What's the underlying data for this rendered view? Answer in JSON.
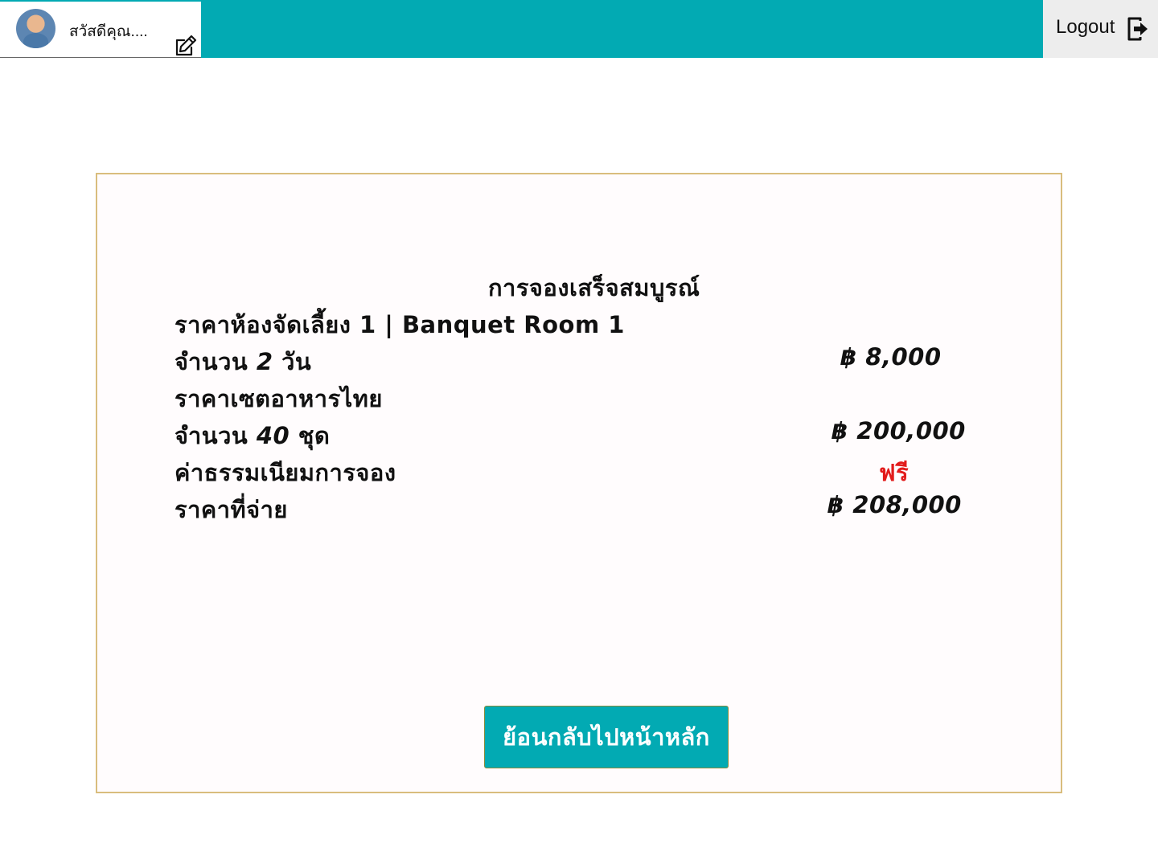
{
  "header": {
    "greeting": "สวัสดีคุณ....",
    "logout_label": "Logout"
  },
  "summary": {
    "title": "การจองเสร็จสมบูรณ์",
    "room_label": "ราคาห้องจัดเลี้ยง 1 | Banquet Room 1",
    "days_prefix": "จำนวน ",
    "days_value": "2",
    "days_suffix": " วัน",
    "room_price": "฿ 8,000",
    "food_label": "ราคาเซตอาหารไทย",
    "sets_prefix": " จำนวน ",
    "sets_value": "40",
    "sets_suffix": " ชุด",
    "food_price": "฿ 200,000",
    "fee_label": "ค่าธรรมเนียมการจอง",
    "fee_value": "ฟรี",
    "total_label": "ราคาที่จ่าย",
    "total_price": "฿ 208,000"
  },
  "actions": {
    "back_label": "ย้อนกลับไปหน้าหลัก"
  },
  "colors": {
    "topbar": "#02aab3",
    "free_text": "#e21b1b",
    "card_border": "#d9bd7d"
  }
}
